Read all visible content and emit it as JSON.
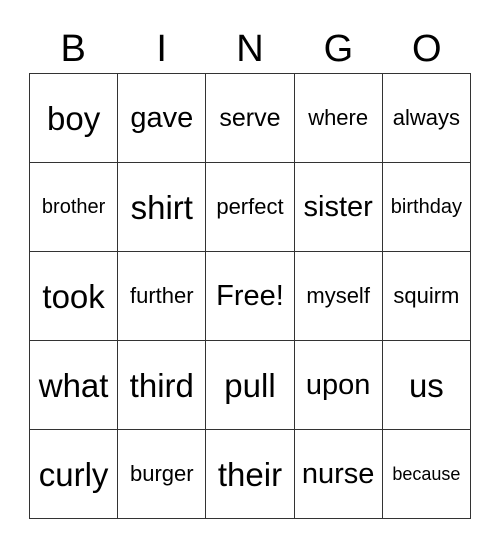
{
  "header": [
    "B",
    "I",
    "N",
    "G",
    "O"
  ],
  "rows": [
    [
      "boy",
      "gave",
      "serve",
      "where",
      "always"
    ],
    [
      "brother",
      "shirt",
      "perfect",
      "sister",
      "birthday"
    ],
    [
      "took",
      "further",
      "Free!",
      "myself",
      "squirm"
    ],
    [
      "what",
      "third",
      "pull",
      "upon",
      "us"
    ],
    [
      "curly",
      "burger",
      "their",
      "nurse",
      "because"
    ]
  ]
}
